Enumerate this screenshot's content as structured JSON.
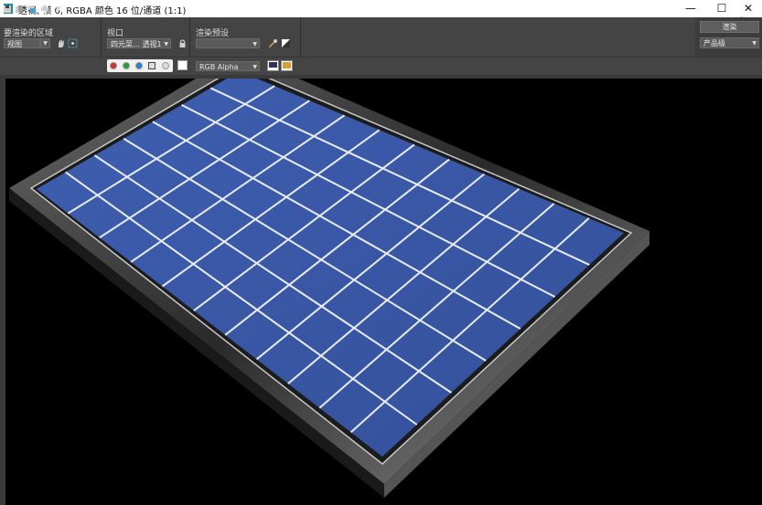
{
  "window": {
    "title": "透视, 帧 0, RGBA 颜色 16 位/通道 (1:1)",
    "minimize": "—",
    "maximize": "☐",
    "close": "✕"
  },
  "toolbar": {
    "area_label": "要渲染的区域",
    "area_value": "视图",
    "viewport_label": "视口",
    "viewport_value": "四元菜… 透视1",
    "preset_label": "渲染预设",
    "preset_value": "",
    "render_button": "渲染",
    "quality_value": "产品级"
  },
  "toolbar2": {
    "channel_value": "RGB Alpha"
  },
  "colors": {
    "red": "#d03030",
    "green": "#2f9a3a",
    "blue": "#2c7fd8",
    "panel_blue": "#3a59a8",
    "cell_line": "#e8ecf6"
  }
}
